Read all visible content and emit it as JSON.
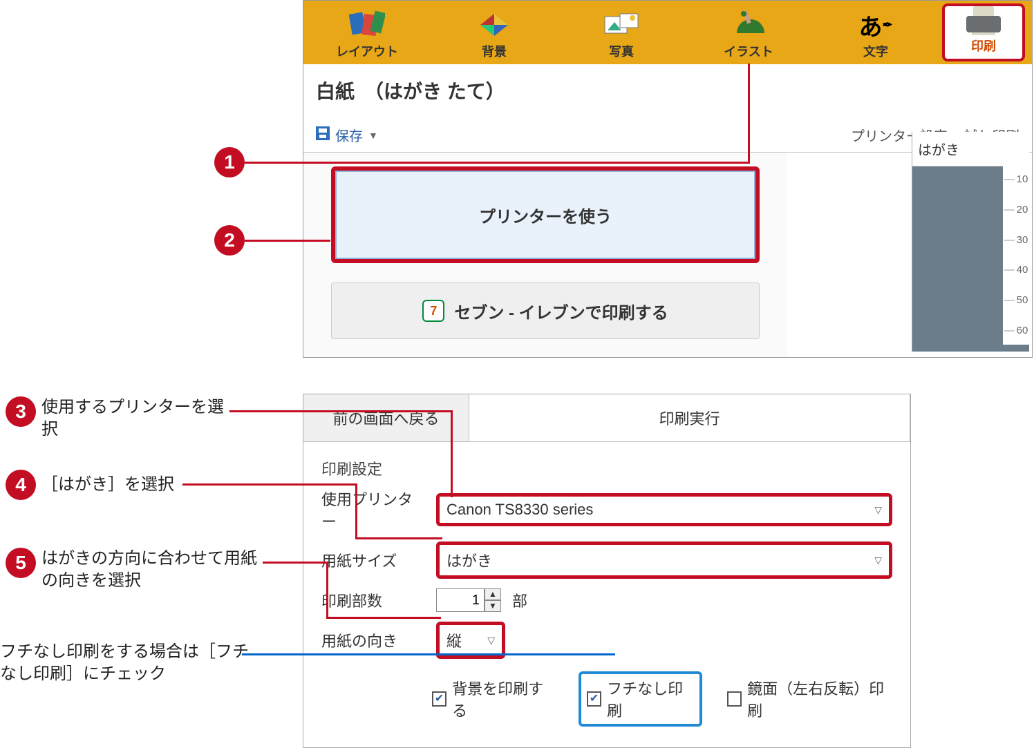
{
  "callouts": {
    "c1": "1",
    "c2": "2",
    "c3_num": "3",
    "c3_text": "使用するプリンターを選択",
    "c4_num": "4",
    "c4_text": "［はがき］を選択",
    "c5_num": "5",
    "c5_text": "はがきの方向に合わせて用紙の向きを選択",
    "borderless_note": "フチなし印刷をする場合は［フチなし印刷］にチェック"
  },
  "tabs": {
    "layout": "レイアウト",
    "background": "背景",
    "photo": "写真",
    "illust": "イラスト",
    "text": "文字",
    "print": "印刷"
  },
  "doc_title": "白紙　（はがき たて）",
  "toolbar": {
    "save": "保存",
    "printer_settings": "プリンター設定",
    "test_print": "試し印刷"
  },
  "buttons": {
    "use_printer": "プリンターを使う",
    "print_at_seven": "セブン - イレブンで印刷する"
  },
  "preview": {
    "label": "はがき",
    "ruler": [
      "10",
      "20",
      "30",
      "40",
      "50",
      "60"
    ]
  },
  "settings": {
    "back": "前の画面へ戻る",
    "execute": "印刷実行",
    "section_title": "印刷設定",
    "printer_label": "使用プリンター",
    "printer_value": "Canon TS8330 series",
    "paper_label": "用紙サイズ",
    "paper_value": "はがき",
    "copies_label": "印刷部数",
    "copies_value": "1",
    "copies_unit": "部",
    "orient_label": "用紙の向き",
    "orient_value": "縦",
    "check_bg": "背景を印刷する",
    "check_borderless": "フチなし印刷",
    "check_mirror": "鏡面（左右反転）印刷"
  }
}
